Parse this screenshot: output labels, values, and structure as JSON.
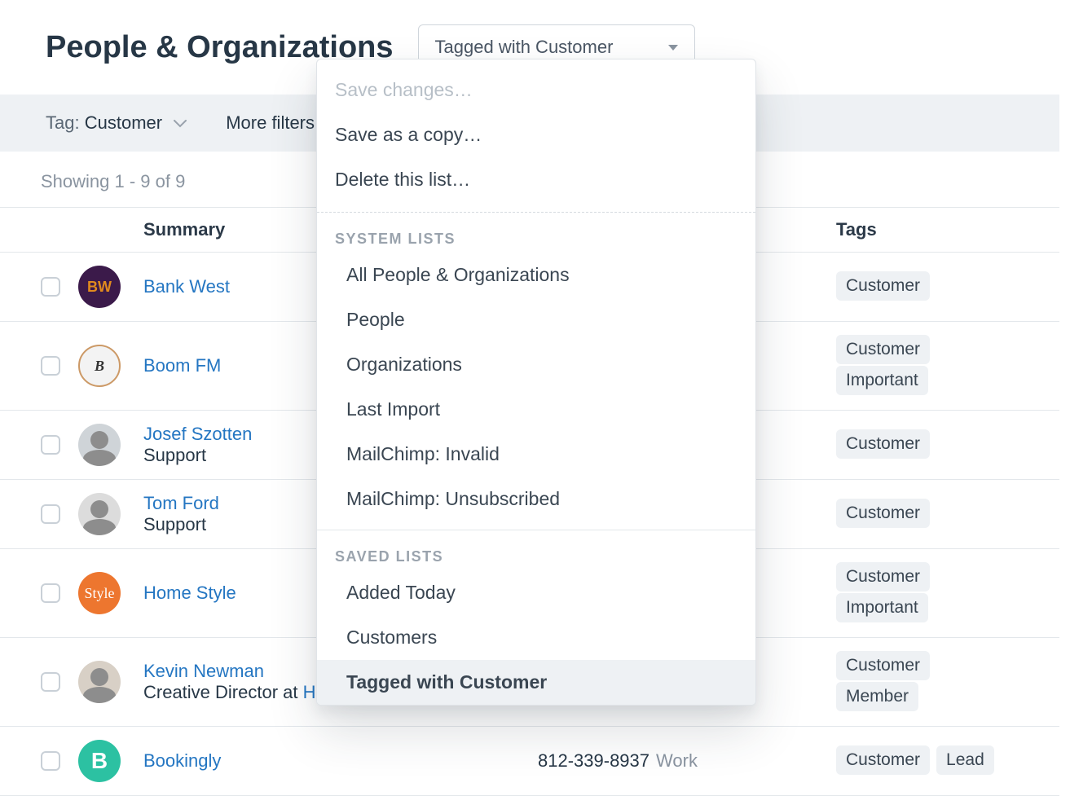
{
  "header": {
    "title": "People & Organizations",
    "selected_list": "Tagged with Customer"
  },
  "filters": {
    "tag_label": "Tag:",
    "tag_value": "Customer",
    "more_filters": "More filters"
  },
  "showing_text": "Showing 1 - 9 of 9",
  "columns": {
    "summary": "Summary",
    "tags": "Tags"
  },
  "rows": [
    {
      "avatar_text": "BW",
      "avatar_class": "bw",
      "name": "Bank West",
      "subtitle": "",
      "phone": "",
      "phone_label": "",
      "tags": [
        "Customer"
      ]
    },
    {
      "avatar_text": "B",
      "avatar_class": "boom",
      "name": "Boom FM",
      "subtitle": "",
      "phone": "",
      "phone_label": "",
      "tags": [
        "Customer",
        "Important"
      ]
    },
    {
      "avatar_text": "",
      "avatar_class": "josef person",
      "name": "Josef Szotten",
      "subtitle": "Support",
      "phone": "",
      "phone_label": "",
      "tags": [
        "Customer"
      ]
    },
    {
      "avatar_text": "",
      "avatar_class": "tom person",
      "name": "Tom Ford",
      "subtitle": "Support",
      "phone": "",
      "phone_label": "",
      "tags": [
        "Customer"
      ]
    },
    {
      "avatar_text": "Style",
      "avatar_class": "style",
      "name": "Home Style",
      "subtitle": "",
      "phone": "",
      "phone_label": "",
      "tags": [
        "Customer",
        "Important"
      ]
    },
    {
      "avatar_text": "",
      "avatar_class": "kevin person",
      "name": "Kevin Newman",
      "subtitle_pre": "Creative Director at ",
      "subtitle_link": "Home Style",
      "phone": "",
      "phone_label": "",
      "tags": [
        "Customer",
        "Member"
      ]
    },
    {
      "avatar_text": "B",
      "avatar_class": "book",
      "name": "Bookingly",
      "subtitle": "",
      "phone": "812-339-8937",
      "phone_label": "Work",
      "tags": [
        "Customer",
        "Lead"
      ]
    }
  ],
  "dropdown": {
    "save_changes": "Save changes…",
    "save_copy": "Save as a copy…",
    "delete_list": "Delete this list…",
    "system_header": "SYSTEM LISTS",
    "system_items": [
      "All People & Organizations",
      "People",
      "Organizations",
      "Last Import",
      "MailChimp: Invalid",
      "MailChimp: Unsubscribed"
    ],
    "saved_header": "SAVED LISTS",
    "saved_items": [
      "Added Today",
      "Customers",
      "Tagged with Customer"
    ],
    "selected": "Tagged with Customer"
  }
}
